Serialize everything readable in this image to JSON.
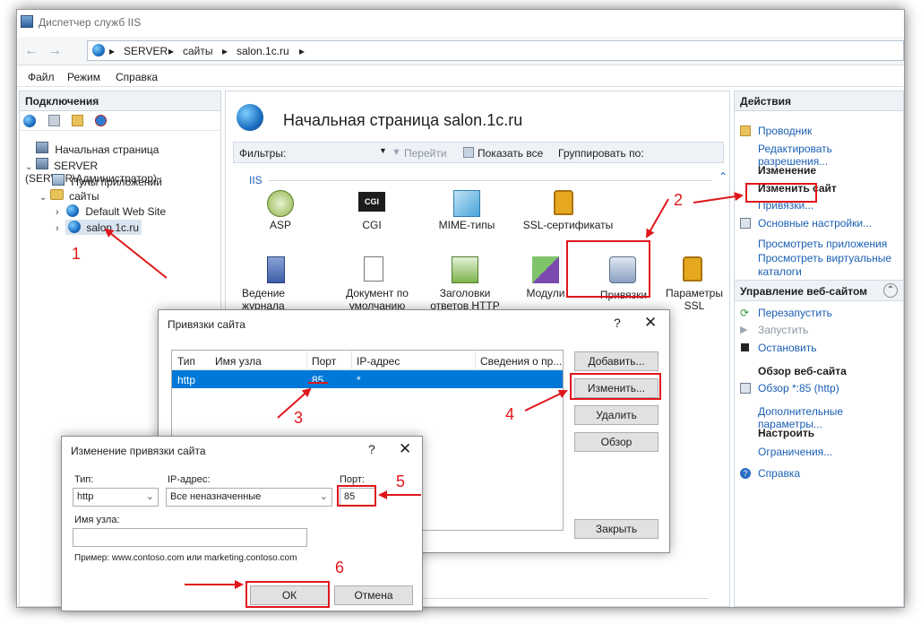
{
  "window": {
    "title": "Диспетчер служб IIS",
    "breadcrumb": [
      "SERVER",
      "сайты",
      "salon.1c.ru"
    ],
    "menu": [
      "Файл",
      "Режим",
      "Справка"
    ]
  },
  "connections": {
    "header": "Подключения",
    "tree": [
      {
        "label": "Начальная страница"
      },
      {
        "label": "SERVER (SERVER\\Администратор)"
      },
      {
        "label": "Пулы приложений"
      },
      {
        "label": "сайты"
      },
      {
        "label": "Default Web Site"
      },
      {
        "label": "salon.1c.ru"
      }
    ]
  },
  "center": {
    "title": "Начальная страница salon.1c.ru",
    "filters_label": "Фильтры:",
    "goto_label": "Перейти",
    "show_all_label": "Показать все",
    "group_by_label": "Группировать по:",
    "group": "IIS",
    "features": [
      {
        "label": "ASP"
      },
      {
        "label": "CGI"
      },
      {
        "label": "MIME-типы"
      },
      {
        "label": "SSL-сертификаты"
      },
      {
        "label": "Ведение журнала"
      },
      {
        "label": "Документ по умолчанию"
      },
      {
        "label": "Заголовки ответов HTTP"
      },
      {
        "label": "Модули"
      },
      {
        "label": "Привязки"
      },
      {
        "label": "Параметры SSL"
      }
    ],
    "cgi_text": "CGI"
  },
  "actions": {
    "header": "Действия",
    "explore": "Проводник",
    "edit_permissions": "Редактировать разрешения...",
    "edit_header": "Изменение",
    "edit_site": "Изменить сайт",
    "bindings": "Привязки...",
    "basic_settings": "Основные настройки...",
    "view_apps": "Просмотреть приложения",
    "view_vdirs": "Просмотреть виртуальные каталоги",
    "manage_header": "Управление веб-сайтом",
    "restart": "Перезапустить",
    "start": "Запустить",
    "stop": "Остановить",
    "browse_header": "Обзор веб-сайта",
    "browse": "Обзор *:85 (http)",
    "advanced": "Дополнительные параметры...",
    "configure_header": "Настроить",
    "limits": "Ограничения...",
    "help": "Справка"
  },
  "bindings_dialog": {
    "title": "Привязки сайта",
    "help": "?",
    "close": "✕",
    "columns": [
      "Тип",
      "Имя узла",
      "Порт",
      "IP-адрес",
      "Сведения о пр..."
    ],
    "rows": [
      {
        "type": "http",
        "host": "",
        "port": "85",
        "ip": "*",
        "info": ""
      }
    ],
    "add": "Добавить...",
    "edit": "Изменить...",
    "remove": "Удалить",
    "browse": "Обзор",
    "close_btn": "Закрыть"
  },
  "edit_dialog": {
    "title": "Изменение привязки сайта",
    "help": "?",
    "close": "✕",
    "type_label": "Тип:",
    "type_value": "http",
    "ip_label": "IP-адрес:",
    "ip_value": "Все неназначенные",
    "port_label": "Порт:",
    "port_value": "85",
    "host_label": "Имя узла:",
    "host_value": "",
    "example": "Пример: www.contoso.com или marketing.contoso.com",
    "ok": "ОК",
    "cancel": "Отмена"
  },
  "annotations": [
    "1",
    "2",
    "3",
    "4",
    "5",
    "6"
  ],
  "colors": {
    "annotation": "#e0161b",
    "link": "#1a5fb4",
    "selection": "#0078d7"
  }
}
